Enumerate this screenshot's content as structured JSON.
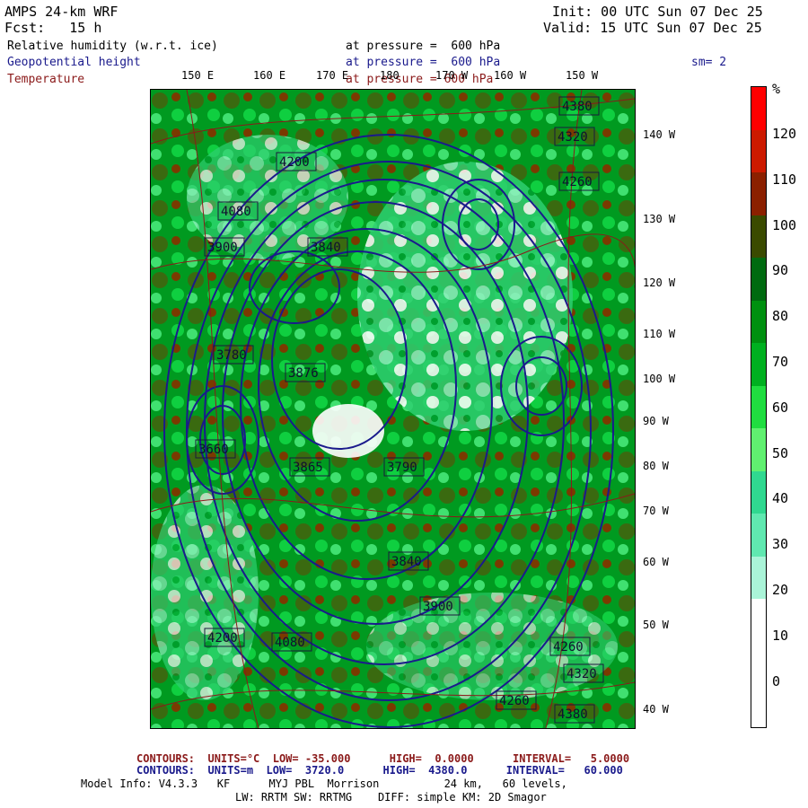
{
  "header": {
    "model": "AMPS 24-km WRF",
    "fcst": "Fcst:   15 h",
    "init": "Init: 00 UTC Sun 07 Dec 25",
    "valid": "Valid: 15 UTC Sun 07 Dec 25",
    "field1_name": "Relative humidity (w.r.t. ice)",
    "field1_level": "at pressure =  600 hPa",
    "field2_name": "Geopotential height",
    "field2_level": "at pressure =  600 hPa",
    "field3_name": "Temperature",
    "field3_level": "at pressure = 600 hPa",
    "smoothing": "sm= 2"
  },
  "top_lon_labels": [
    "150 E",
    "160 E",
    "170 E",
    "180",
    "170 W",
    "160 W",
    "150 W"
  ],
  "right_lon_labels": [
    "140 W",
    "130 W",
    "120 W",
    "110 W",
    "100 W",
    "90 W",
    "80 W",
    "70 W",
    "60 W",
    "50 W",
    "40 W"
  ],
  "colorbar": {
    "unit": "%",
    "ticks": [
      "120",
      "110",
      "100",
      "90",
      "80",
      "70",
      "60",
      "50",
      "40",
      "30",
      "20",
      "10",
      "0"
    ],
    "colors": [
      "#ff0000",
      "#cc1a00",
      "#8b2000",
      "#3a4a00",
      "#006a10",
      "#009010",
      "#00b020",
      "#20dd40",
      "#60f070",
      "#30d890",
      "#60e8b0",
      "#aaf4d8",
      "#ffffff",
      "#ffffff",
      "#ffffff"
    ]
  },
  "contour_labels": [
    {
      "t": "4380"
    },
    {
      "t": "4320"
    },
    {
      "t": "4260"
    },
    {
      "t": "4200"
    },
    {
      "t": "4080"
    },
    {
      "t": "3900"
    },
    {
      "t": "3840"
    },
    {
      "t": "3780"
    },
    {
      "t": "3876"
    },
    {
      "t": "3660"
    },
    {
      "t": "3865"
    },
    {
      "t": "3790"
    },
    {
      "t": "4320"
    },
    {
      "t": "4380"
    },
    {
      "t": "4260"
    },
    {
      "t": "4200"
    },
    {
      "t": "4080"
    },
    {
      "t": "3900"
    },
    {
      "t": "3840"
    },
    {
      "t": "4260"
    }
  ],
  "footer": {
    "contours_t": "CONTOURS:  UNITS=°C  LOW= -35.000      HIGH=  0.0000      INTERVAL=   5.0000",
    "contours_z": "CONTOURS:  UNITS=m  LOW=  3720.0      HIGH=  4380.0      INTERVAL=   60.000",
    "model_info": "Model Info: V4.3.3   KF      MYJ PBL  Morrison          24 km,   60 levels,",
    "physics": "LW: RRTM SW: RRTMG    DIFF: simple KM: 2D Smagor"
  }
}
